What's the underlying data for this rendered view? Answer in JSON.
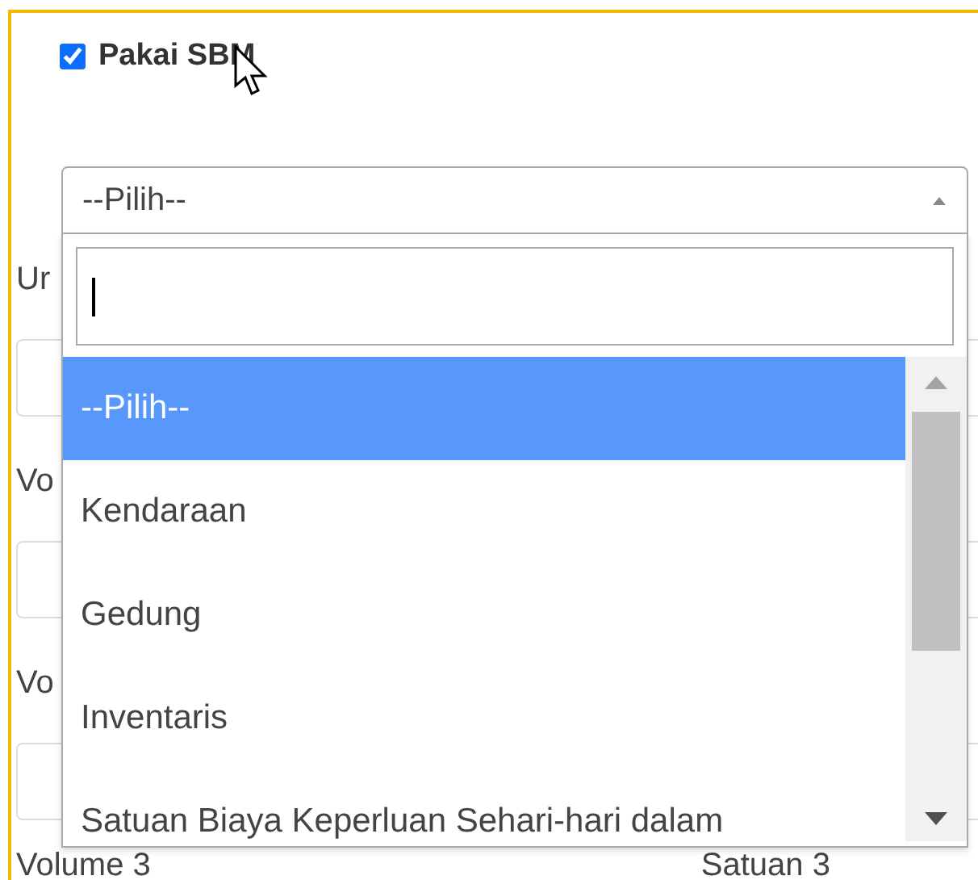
{
  "checkbox": {
    "label": "Pakai SBM",
    "checked": true
  },
  "select": {
    "value": "--Pilih--",
    "expanded": true
  },
  "options": [
    {
      "label": "--Pilih--",
      "selected": true
    },
    {
      "label": "Kendaraan",
      "selected": false
    },
    {
      "label": "Gedung",
      "selected": false
    },
    {
      "label": "Inventaris",
      "selected": false
    },
    {
      "label": "Satuan Biaya Keperluan Sehari-hari dalam",
      "selected": false
    }
  ],
  "background_fields": [
    {
      "label": "Ur"
    },
    {
      "label": "Vo"
    },
    {
      "label": "Vo"
    }
  ],
  "bottom_labels": [
    "Volume 3",
    "Satuan 3"
  ]
}
